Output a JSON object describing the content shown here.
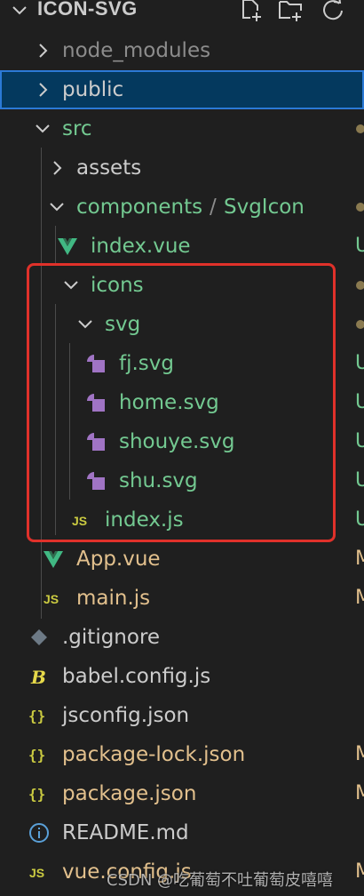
{
  "header": {
    "title": "ICON-SVG",
    "icons": [
      "new-file-icon",
      "new-folder-icon",
      "refresh-icon"
    ]
  },
  "colors": {
    "background": "#1f1f1f",
    "selected_bg": "#04395e",
    "selected_border": "#2b79d6",
    "untracked_green": "#73c991",
    "modified_yellow": "#e2c08d",
    "ignored_gray": "#8c8c8c",
    "vue_green": "#41b883",
    "svg_purple": "#a074c4",
    "json_yellow": "#cbcb41",
    "js_yellow": "#cbcb41",
    "highlight_red": "#e0312a"
  },
  "tree": [
    {
      "label": "node_modules",
      "type": "folder",
      "state": "collapsed",
      "icon": "chevron-right-icon"
    },
    {
      "label": "public",
      "type": "folder",
      "state": "collapsed",
      "icon": "chevron-right-icon"
    },
    {
      "label": "src",
      "type": "folder",
      "state": "expanded",
      "icon": "chevron-down-icon"
    },
    {
      "label": "assets",
      "type": "folder",
      "state": "collapsed",
      "icon": "chevron-right-icon"
    },
    {
      "label": "components",
      "label_suffix": "SvgIcon",
      "type": "folder",
      "state": "expanded",
      "icon": "chevron-down-icon"
    },
    {
      "label": "index.vue",
      "type": "file",
      "icon": "vue-file-icon",
      "status": "U"
    },
    {
      "label": "icons",
      "type": "folder",
      "state": "expanded",
      "icon": "chevron-down-icon"
    },
    {
      "label": "svg",
      "type": "folder",
      "state": "expanded",
      "icon": "chevron-down-icon"
    },
    {
      "label": "fj.svg",
      "type": "file",
      "icon": "svg-file-icon",
      "status": "U"
    },
    {
      "label": "home.svg",
      "type": "file",
      "icon": "svg-file-icon",
      "status": "U"
    },
    {
      "label": "shouye.svg",
      "type": "file",
      "icon": "svg-file-icon",
      "status": "U"
    },
    {
      "label": "shu.svg",
      "type": "file",
      "icon": "svg-file-icon",
      "status": "U"
    },
    {
      "label": "index.js",
      "type": "file",
      "icon": "js-file-icon",
      "status": "U"
    },
    {
      "label": "App.vue",
      "type": "file",
      "icon": "vue-file-icon",
      "status": "M"
    },
    {
      "label": "main.js",
      "type": "file",
      "icon": "js-file-icon",
      "status": "M"
    },
    {
      "label": ".gitignore",
      "type": "file",
      "icon": "git-file-icon"
    },
    {
      "label": "babel.config.js",
      "type": "file",
      "icon": "babel-file-icon"
    },
    {
      "label": "jsconfig.json",
      "type": "file",
      "icon": "json-file-icon"
    },
    {
      "label": "package-lock.json",
      "type": "file",
      "icon": "json-file-icon",
      "status": "M"
    },
    {
      "label": "package.json",
      "type": "file",
      "icon": "json-file-icon",
      "status": "M"
    },
    {
      "label": "README.md",
      "type": "file",
      "icon": "info-file-icon"
    },
    {
      "label": "vue.config.js",
      "type": "file",
      "icon": "js-file-icon",
      "status": "M"
    }
  ],
  "watermark": "CSDN @吃葡萄不吐葡萄皮嘻嘻"
}
